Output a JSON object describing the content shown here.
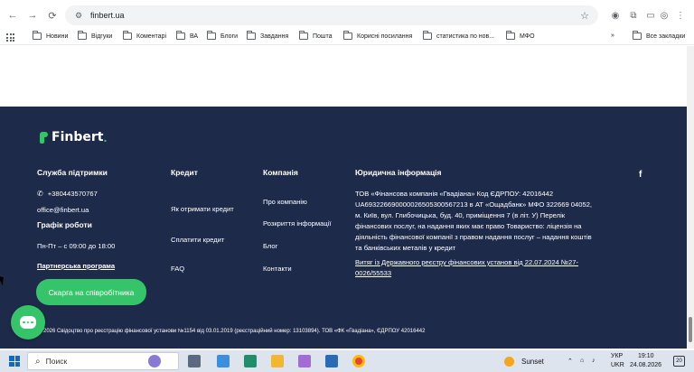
{
  "browser": {
    "url": "finbert.ua",
    "bookmarks": [
      "Новини",
      "Відгуки",
      "Коментарі",
      "ВА",
      "Блоги",
      "Завдання",
      "Пошта",
      "Корисні посилання",
      "статистика по нов...",
      "МФО"
    ],
    "overflow": "»",
    "all_bookmarks": "Все закладки"
  },
  "footer": {
    "logo": "Finbert",
    "logo_dot": ".",
    "support": {
      "heading": "Служба підтримки",
      "phone": "+380443570767",
      "email": "office@finbert.ua",
      "schedule_heading": "Графік роботи",
      "schedule": "Пн-Пт – с 09:00 до 18:00",
      "partner": "Партнерська програма",
      "complaint_button": "Скарга на співробітника"
    },
    "credit": {
      "heading": "Кредит",
      "links": [
        "Як отримати кредит",
        "Сплатити кредит",
        "FAQ"
      ]
    },
    "company": {
      "heading": "Компанія",
      "links": [
        "Про компанію",
        "Розкриття інформації",
        "Блог",
        "Контакти"
      ]
    },
    "legal": {
      "heading": "Юридична інформація",
      "text": "ТОВ «Фінансова компанія «Гвадіана» Код ЄДРПОУ: 42016442 UA693226690000026505300567213 в АТ «Ощадбанк» МФО 322669 04052, м. Київ, вул. Глибочицька, буд. 40, приміщення 7 (в літ. У) Перелік фінансових послуг, на надання яких має право Товариство: ліцензія на діяльність фінансової компанії з правом надання послуг – надання коштів та банківських металів у кредит",
      "link": "Витяг із Державного реєстру фінансових установ від 22.07.2024 №27-0026/55533"
    },
    "facebook": "f",
    "copyright": "2026 Свідоцтво про реєстрацію фінансової установи №1154 від 03.01.2019 (реєстраційний номер: 13103894). ТОВ «ФК «Гвадіана», ЄДРПОУ 42016442"
  },
  "taskbar": {
    "search": "Поиск",
    "weather": "Sunset",
    "lang_top": "УКР",
    "lang_bottom": "UKR",
    "time": "19:10",
    "date": "24.08.2026",
    "notifications": "20"
  }
}
